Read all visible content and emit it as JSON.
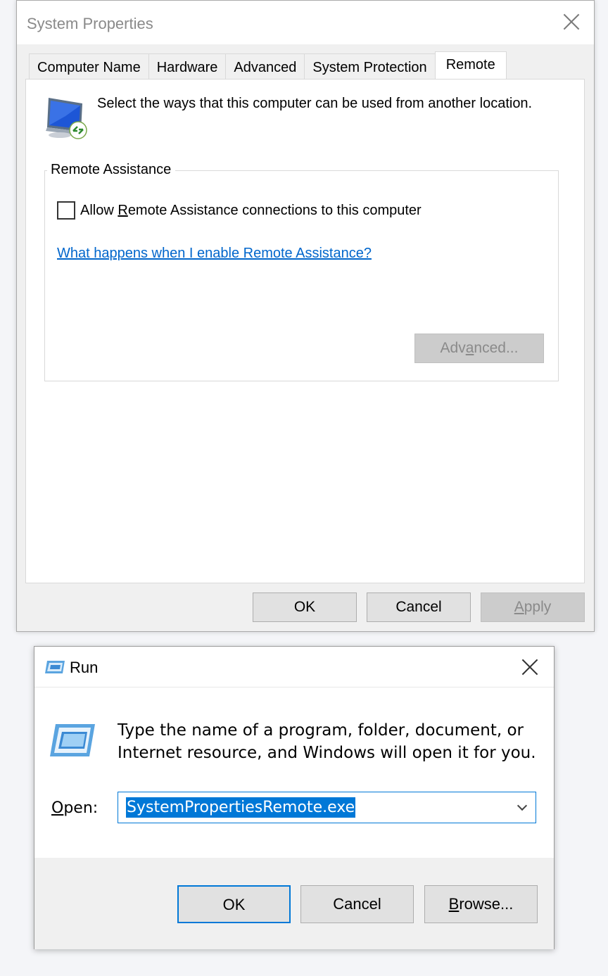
{
  "system_properties": {
    "title": "System Properties",
    "tabs": [
      {
        "label": "Computer Name",
        "active": false
      },
      {
        "label": "Hardware",
        "active": false
      },
      {
        "label": "Advanced",
        "active": false
      },
      {
        "label": "System Protection",
        "active": false
      },
      {
        "label": "Remote",
        "active": true
      }
    ],
    "intro_text": "Select the ways that this computer can be used from another location.",
    "remote_assistance": {
      "group_label": "Remote Assistance",
      "checkbox_label_pre": "Allow ",
      "checkbox_label_mnemonic": "R",
      "checkbox_label_post": "emote Assistance connections to this computer",
      "checkbox_checked": false,
      "help_link": "What happens when I enable Remote Assistance?",
      "advanced_button_pre": "Adv",
      "advanced_button_mnemonic": "a",
      "advanced_button_post": "nced..."
    },
    "buttons": {
      "ok": "OK",
      "cancel": "Cancel",
      "apply_mnemonic": "A",
      "apply_rest": "pply"
    }
  },
  "run_dialog": {
    "title": "Run",
    "description": "Type the name of a program, folder, document, or Internet resource, and Windows will open it for you.",
    "open_label_mnemonic": "O",
    "open_label_rest": "pen:",
    "command_value": "SystemPropertiesRemote.exe",
    "buttons": {
      "ok": "OK",
      "cancel": "Cancel",
      "browse_mnemonic": "B",
      "browse_rest": "rowse..."
    }
  },
  "colors": {
    "accent": "#0078d7",
    "link": "#0066cc",
    "dialog_bg": "#f0f0f0"
  }
}
